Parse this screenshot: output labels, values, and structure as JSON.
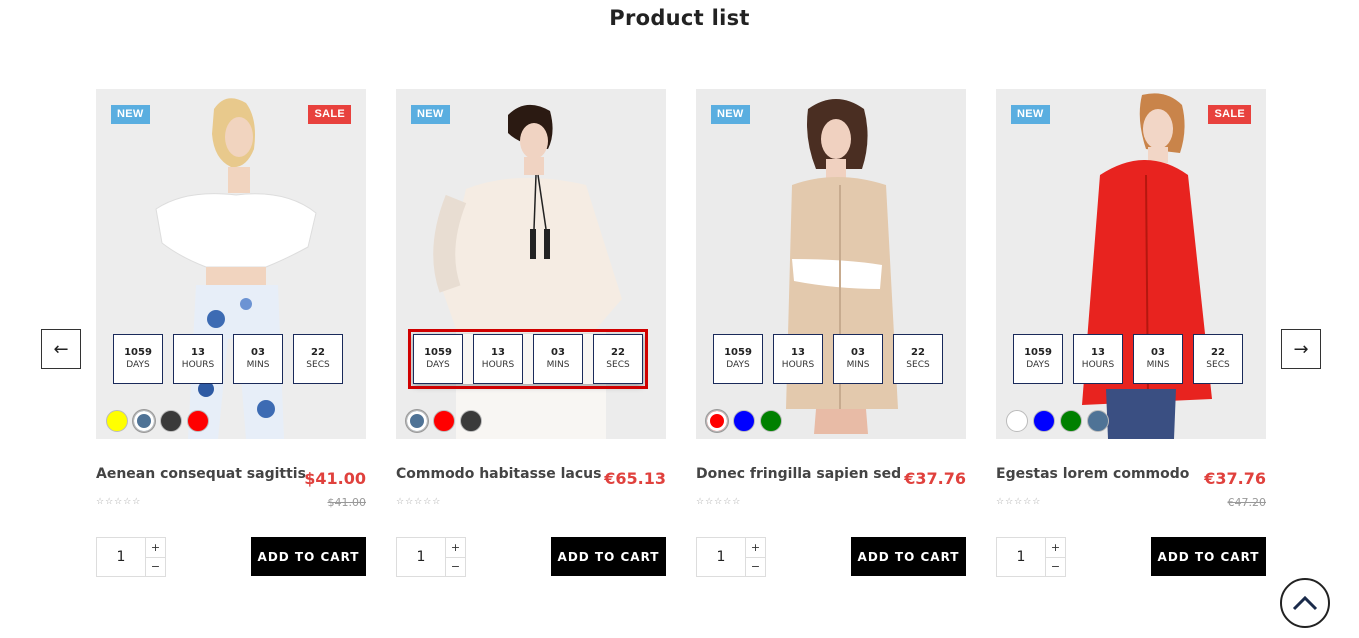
{
  "page": {
    "title": "Product list"
  },
  "nav": {
    "prev_glyph": "←",
    "next_glyph": "→"
  },
  "countdown_labels": {
    "days": "DAYS",
    "hours": "HOURS",
    "mins": "MINS",
    "secs": "SECS"
  },
  "products": [
    {
      "name": "Aenean consequat sagittis",
      "price": "$41.00",
      "old_price": "$41.00",
      "badges": {
        "new": "NEW",
        "sale": "SALE"
      },
      "countdown": {
        "days": "1059",
        "hours": "13",
        "mins": "03",
        "secs": "22"
      },
      "swatches": [
        "#ffff00",
        "#4f7396",
        "#3a3a3a",
        "#ff0000"
      ],
      "quantity": "1",
      "add_to_cart": "ADD TO CART",
      "stars": "☆☆☆☆☆"
    },
    {
      "name": "Commodo habitasse lacus",
      "price": "€65.13",
      "old_price": "",
      "badges": {
        "new": "NEW",
        "sale": ""
      },
      "countdown": {
        "days": "1059",
        "hours": "13",
        "mins": "03",
        "secs": "22"
      },
      "swatches": [
        "#4f7396",
        "#ff0000",
        "#3a3a3a"
      ],
      "quantity": "1",
      "add_to_cart": "ADD TO CART",
      "stars": "☆☆☆☆☆"
    },
    {
      "name": "Donec fringilla sapien sed",
      "price": "€37.76",
      "old_price": "",
      "badges": {
        "new": "NEW",
        "sale": ""
      },
      "countdown": {
        "days": "1059",
        "hours": "13",
        "mins": "03",
        "secs": "22"
      },
      "swatches": [
        "#ff0000",
        "#0000ff",
        "#008000"
      ],
      "quantity": "1",
      "add_to_cart": "ADD TO CART",
      "stars": "☆☆☆☆☆"
    },
    {
      "name": "Egestas lorem commodo",
      "price": "€37.76",
      "old_price": "€47.20",
      "badges": {
        "new": "NEW",
        "sale": "SALE"
      },
      "countdown": {
        "days": "1059",
        "hours": "13",
        "mins": "03",
        "secs": "22"
      },
      "swatches": [
        "#ffffff",
        "#0000ff",
        "#008000",
        "#4f7396"
      ],
      "quantity": "1",
      "add_to_cart": "ADD TO CART",
      "stars": "☆☆☆☆☆"
    }
  ],
  "colors": {
    "accent_price": "#e0413d",
    "badge_new": "#5aaee0",
    "badge_sale": "#e8413d",
    "button": "#000000"
  }
}
